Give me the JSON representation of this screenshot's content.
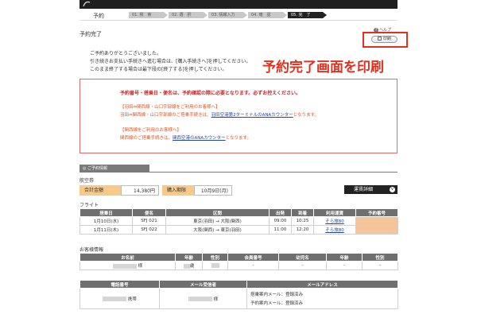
{
  "header": {
    "section_label": "予約",
    "steps": [
      {
        "label": "01. 検　索",
        "active": false
      },
      {
        "label": "02. 選　択",
        "active": false
      },
      {
        "label": "03. 情報入力",
        "active": false
      },
      {
        "label": "04. 確　認",
        "active": false
      },
      {
        "label": "05. 完　了",
        "active": true
      }
    ]
  },
  "page": {
    "title": "予約完了",
    "help_label": "ヘルプ",
    "print_label": "印刷",
    "notice_lines": [
      "ご予約ありがとうございました。",
      "引き続きお支払い手続きへ進む場合は、[購入手続きへ]を押してください。",
      "このまま終了する場合は最下段の[終了する]を押してください。"
    ],
    "callout": "予約完了画面を印刷"
  },
  "warning": {
    "headline": "予約番号・搭乗日・便名は、予約確認の際に必要となります。必ずお控えください。",
    "haneda_heading": "【羽田⇔関西線・山口宇部線をご利用のお客様へ】",
    "haneda_pre": "羽田⇔関西線・山口宇部線のご搭乗手続きは、",
    "haneda_link": "羽田空港第2ターミナルのANAカウンター",
    "haneda_post": "となります。",
    "kansai_heading": "【関西線をご利用のお客様へ】",
    "kansai_pre": "関西線のご搭乗手続きは、",
    "kansai_link": "関西空港のANAカウンター",
    "kansai_post": "となります。"
  },
  "reservation": {
    "section_title": "ご予約情報",
    "ticket_heading": "航空券",
    "total_label": "合計金額",
    "total_value": "14,380円",
    "deadline_label": "購入期限",
    "deadline_value": "10月9日(月)",
    "fare_detail_label": "運賃詳細",
    "flight_heading": "フライト",
    "flight_columns": [
      "搭乗日",
      "便名",
      "区間",
      "出発",
      "到着",
      "利用運賃",
      "予約番号"
    ],
    "flights": [
      {
        "date": "1月10日(水)",
        "flight": "SFJ 021",
        "route": "東京(羽田) → 大阪(関西)",
        "dep": "09:00",
        "arr": "10:25",
        "fare": "そら旅80"
      },
      {
        "date": "1月11日(木)",
        "flight": "SFJ 022",
        "route": "大阪(関西) → 東京(羽田)",
        "dep": "11:00",
        "arr": "12:20",
        "fare": "そら旅80"
      }
    ],
    "passenger_heading": "お客様情報",
    "passenger_columns": [
      "お名前",
      "年齢",
      "性別",
      "会員番号",
      "幼児名",
      "年齢",
      "性別"
    ],
    "passenger": {
      "name_suffix": "様",
      "age_suffix": "歳",
      "member": "-",
      "infant": "-",
      "infant_age": "-",
      "infant_sex": "-"
    },
    "contact_columns": [
      "電話番号",
      "メール受信者",
      "メールアドレス"
    ],
    "contact": {
      "phone_type": "携帯",
      "recipient_suffix": "様",
      "mail_line1": "搭乗案内メール：登録済み",
      "mail_line2": "予約案内メール：登録済み"
    }
  }
}
